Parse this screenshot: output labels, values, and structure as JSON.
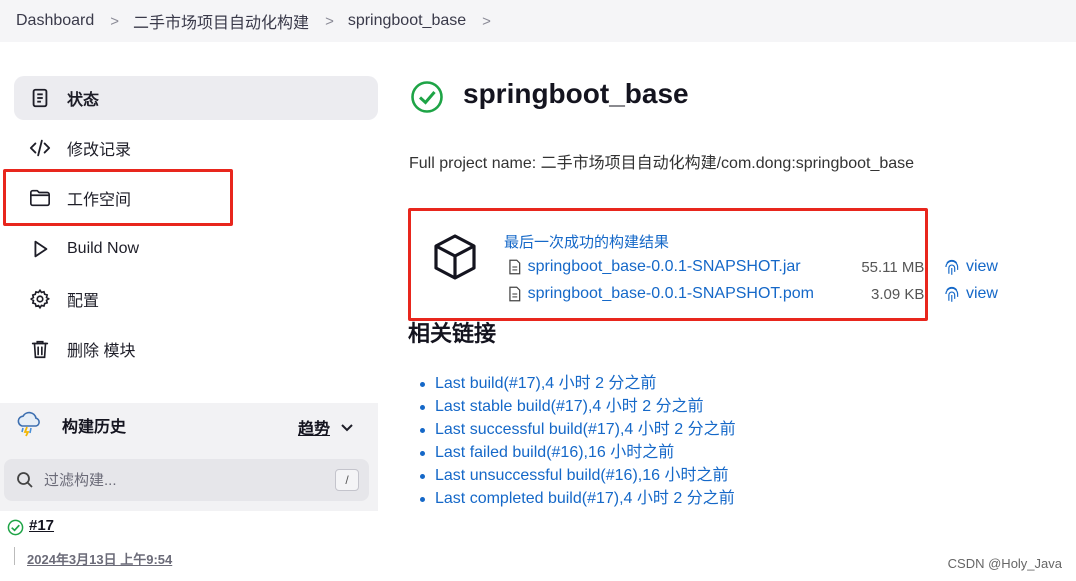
{
  "breadcrumb": {
    "items": [
      "Dashboard",
      "二手市场项目自动化构建",
      "springboot_base"
    ],
    "separator": ">"
  },
  "sidebar": {
    "tasks": [
      {
        "label": "状态",
        "icon": "document-icon",
        "active": true
      },
      {
        "label": "修改记录",
        "icon": "code-icon",
        "active": false
      },
      {
        "label": "工作空间",
        "icon": "folder-icon",
        "active": false
      },
      {
        "label": "Build Now",
        "icon": "play-icon",
        "active": false
      },
      {
        "label": "配置",
        "icon": "gear-icon",
        "active": false
      },
      {
        "label": "删除 模块",
        "icon": "trash-icon",
        "active": false
      }
    ],
    "highlight_color": "#e8261d"
  },
  "build_history": {
    "title": "构建历史",
    "trend_label": "趋势",
    "filter_placeholder": "过滤构建...",
    "shortcut": "/",
    "builds": [
      {
        "number": "#17",
        "status": "success",
        "date": "2024年3月13日 上午9:54"
      }
    ]
  },
  "main": {
    "title": "springboot_base",
    "status": "success",
    "full_name": "Full project name: 二手市场项目自动化构建/com.dong:springboot_base",
    "last_success_label": "最后一次成功的构建结果",
    "artifacts": [
      {
        "name": "springboot_base-0.0.1-SNAPSHOT.jar",
        "size": "55.11 MB",
        "view_label": "view"
      },
      {
        "name": "springboot_base-0.0.1-SNAPSHOT.pom",
        "size": "3.09 KB",
        "view_label": "view"
      }
    ],
    "related_title": "相关链接",
    "related_links": [
      "Last build(#17),4 小时 2 分之前",
      "Last stable build(#17),4 小时 2 分之前",
      "Last successful build(#17),4 小时 2 分之前",
      "Last failed build(#16),16 小时之前",
      "Last unsuccessful build(#16),16 小时之前",
      "Last completed build(#17),4 小时 2 分之前"
    ]
  },
  "watermark": "CSDN @Holy_Java",
  "colors": {
    "success": "#1ea446",
    "link": "#1568c8",
    "highlight": "#e8261d"
  }
}
